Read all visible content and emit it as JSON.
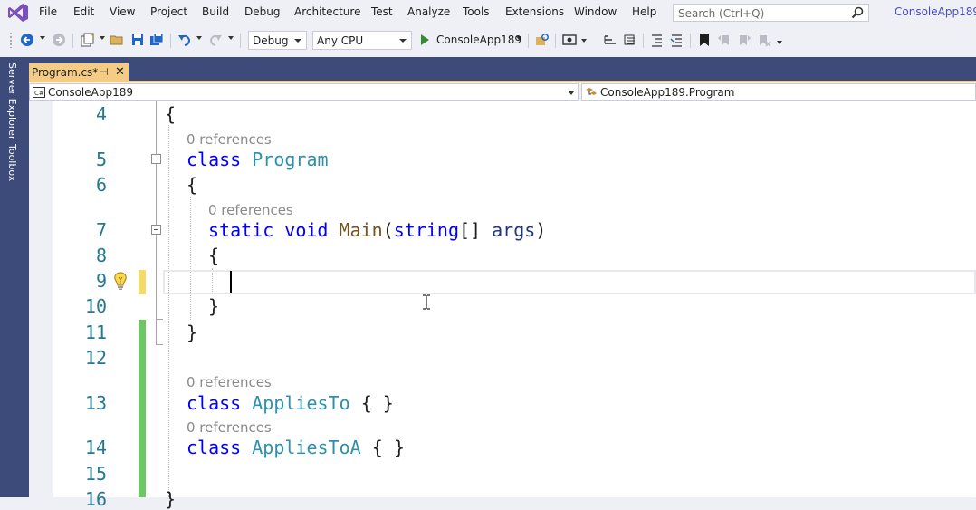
{
  "menu": {
    "items": [
      "File",
      "Edit",
      "View",
      "Project",
      "Build",
      "Debug",
      "Architecture",
      "Test",
      "Analyze",
      "Tools",
      "Extensions",
      "Window",
      "Help"
    ],
    "search_placeholder": "Search (Ctrl+Q)",
    "solution_name": "ConsoleApp189"
  },
  "toolbar": {
    "configuration": "Debug",
    "platform": "Any CPU",
    "start_target": "ConsoleApp189"
  },
  "side_tabs": [
    "Server Explorer",
    "Toolbox"
  ],
  "document_tab": {
    "label": "Program.cs*",
    "pin_glyph": "⊣",
    "close_glyph": "✕"
  },
  "navbar": {
    "project": "ConsoleApp189",
    "type": "ConsoleApp189.Program"
  },
  "editor": {
    "lines": [
      {
        "n": "4"
      },
      {
        "n": "5"
      },
      {
        "n": "6"
      },
      {
        "n": "7"
      },
      {
        "n": "8"
      },
      {
        "n": "9"
      },
      {
        "n": "10"
      },
      {
        "n": "11"
      },
      {
        "n": "12"
      },
      {
        "n": "13"
      },
      {
        "n": "14"
      },
      {
        "n": "15"
      },
      {
        "n": "16"
      }
    ],
    "codelens": "0 references",
    "code": {
      "open_brace": "{",
      "close_brace": "}",
      "kw_class": "class",
      "kw_static": "static",
      "kw_void": "void",
      "kw_string": "string",
      "program": "Program",
      "main": "Main",
      "args": "args",
      "applies_to": "AppliesTo",
      "applies_to_a": "AppliesToA",
      "empty_body": "{ }"
    }
  },
  "colors": {
    "accent": "#3d4b7a",
    "active_tab": "#f5cc84",
    "keyword": "#0000ff",
    "type": "#2b91af",
    "line_number": "#237893",
    "saved_change": "#6ec664",
    "unsaved_change": "#f6d96b"
  },
  "icons": [
    "visual-studio-logo",
    "search-icon",
    "back-icon",
    "forward-icon",
    "new-project-icon",
    "open-icon",
    "save-icon",
    "save-all-icon",
    "undo-icon",
    "redo-icon",
    "start-icon",
    "lightbulb-icon",
    "ibeam-cursor-icon",
    "csharp-project-icon",
    "class-icon"
  ]
}
